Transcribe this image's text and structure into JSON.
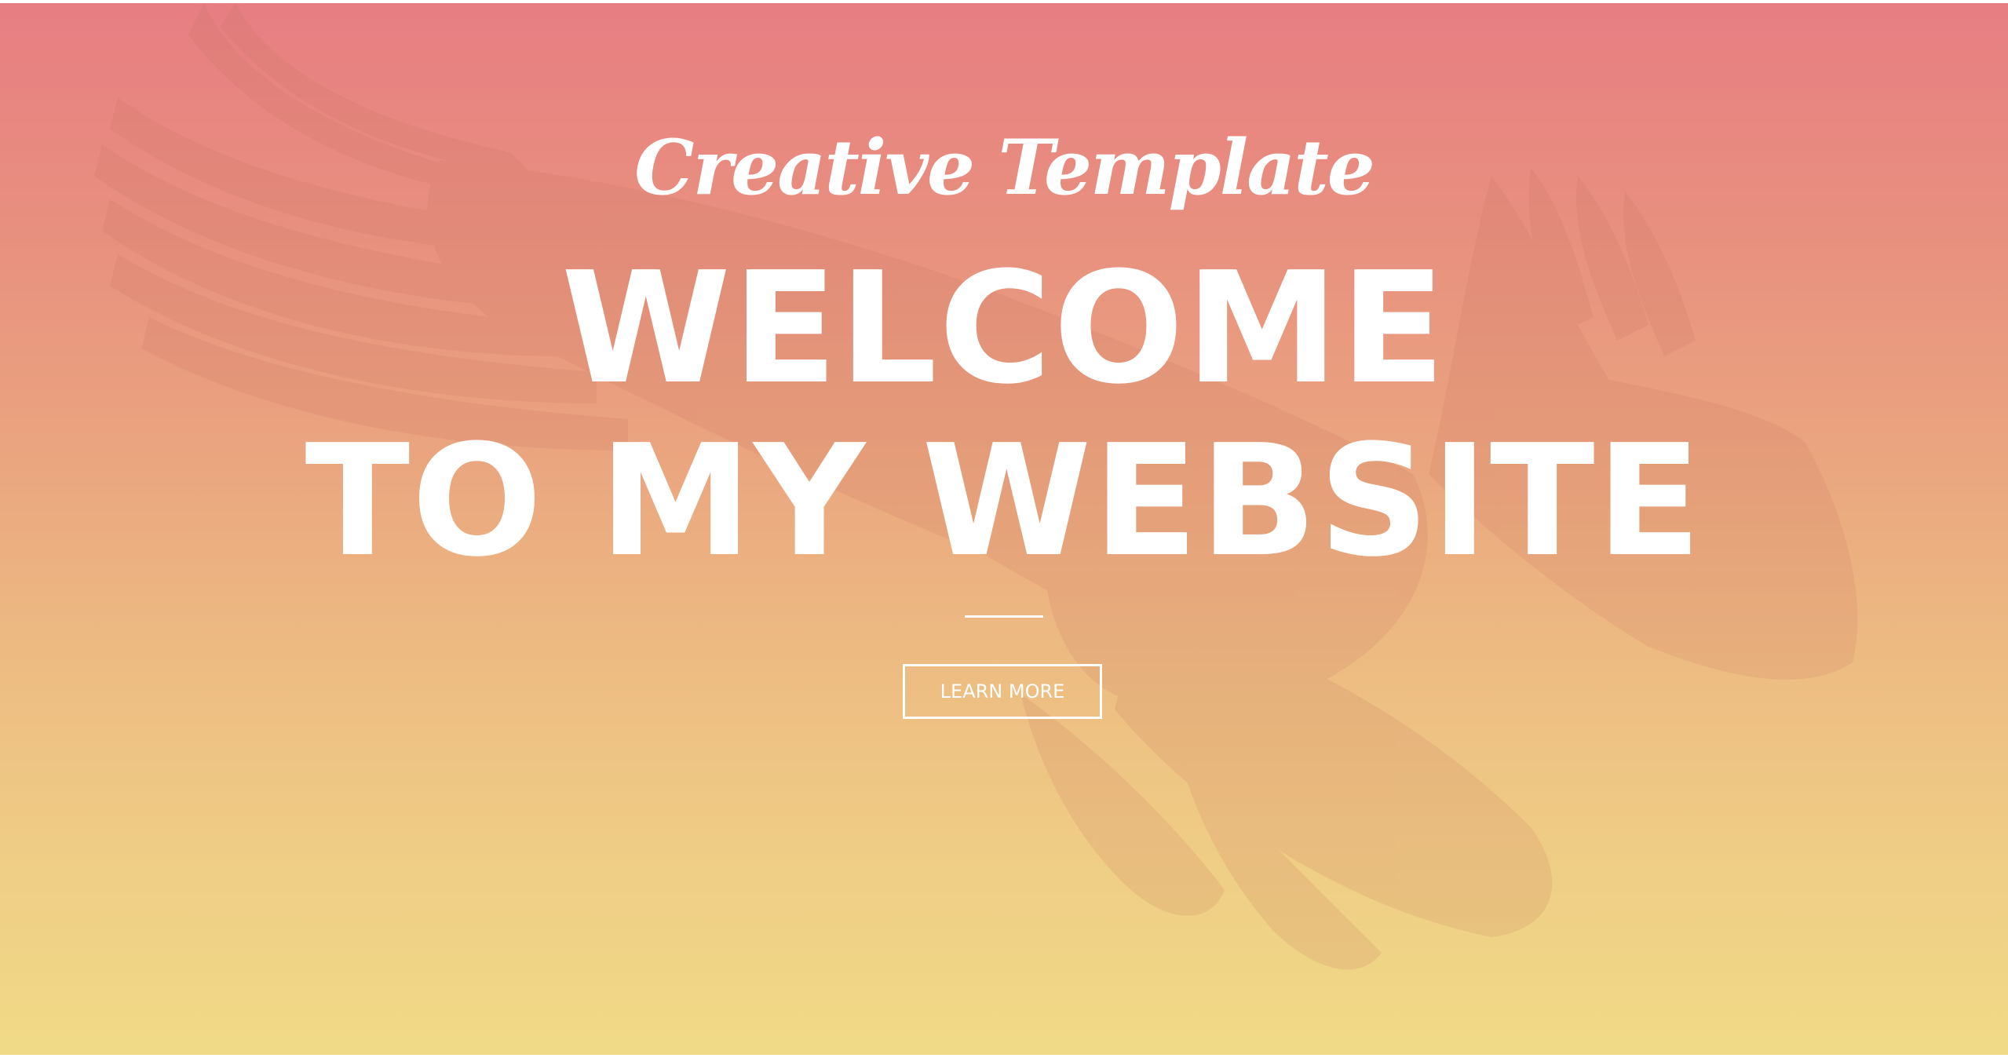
{
  "hero": {
    "tagline": "Creative Template",
    "headline_line1": "WELCOME",
    "headline_line2": "TO MY WEBSITE",
    "cta_label": "LEARN MORE",
    "background_image": "eagle-silhouette",
    "gradient_colors": [
      "#e77e82",
      "#eaa47f",
      "#f0da87"
    ]
  }
}
